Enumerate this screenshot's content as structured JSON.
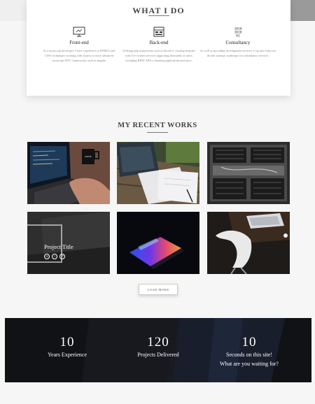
{
  "what_i_do": {
    "title": "WHAT I DO",
    "services": [
      {
        "icon": "monitor-icon",
        "title": "Front-end",
        "text": "As a javascript developer, I have experience in HTML5 and CSS3 techniques working with jQuery or more advanced javascript MVC frameworks such as angular"
      },
      {
        "icon": "server-code-icon",
        "title": "Back-end",
        "text": "Utilising php frameworks such as Kirell or creating bespoke code I've written services supporting thousands of users, including REST APIs a learning applications and more."
      },
      {
        "icon": "binary-icon",
        "title": "Consultancy",
        "text": "As well as providing development services, I can also help you decide strategic roadmaps via consultancy services."
      }
    ]
  },
  "recent_works": {
    "title": "MY RECENT WORKS",
    "featured_project": {
      "title": "Project Title",
      "icons": [
        "link-icon",
        "zoom-icon",
        "share-icon"
      ]
    },
    "load_more_label": "LOAD MORE"
  },
  "stats": [
    {
      "value": "10",
      "label": "Years Experience"
    },
    {
      "value": "120",
      "label": "Projects Delivered"
    },
    {
      "value": "10",
      "label": "Seconds on this site!",
      "label2": "What are you waiting for?"
    }
  ]
}
